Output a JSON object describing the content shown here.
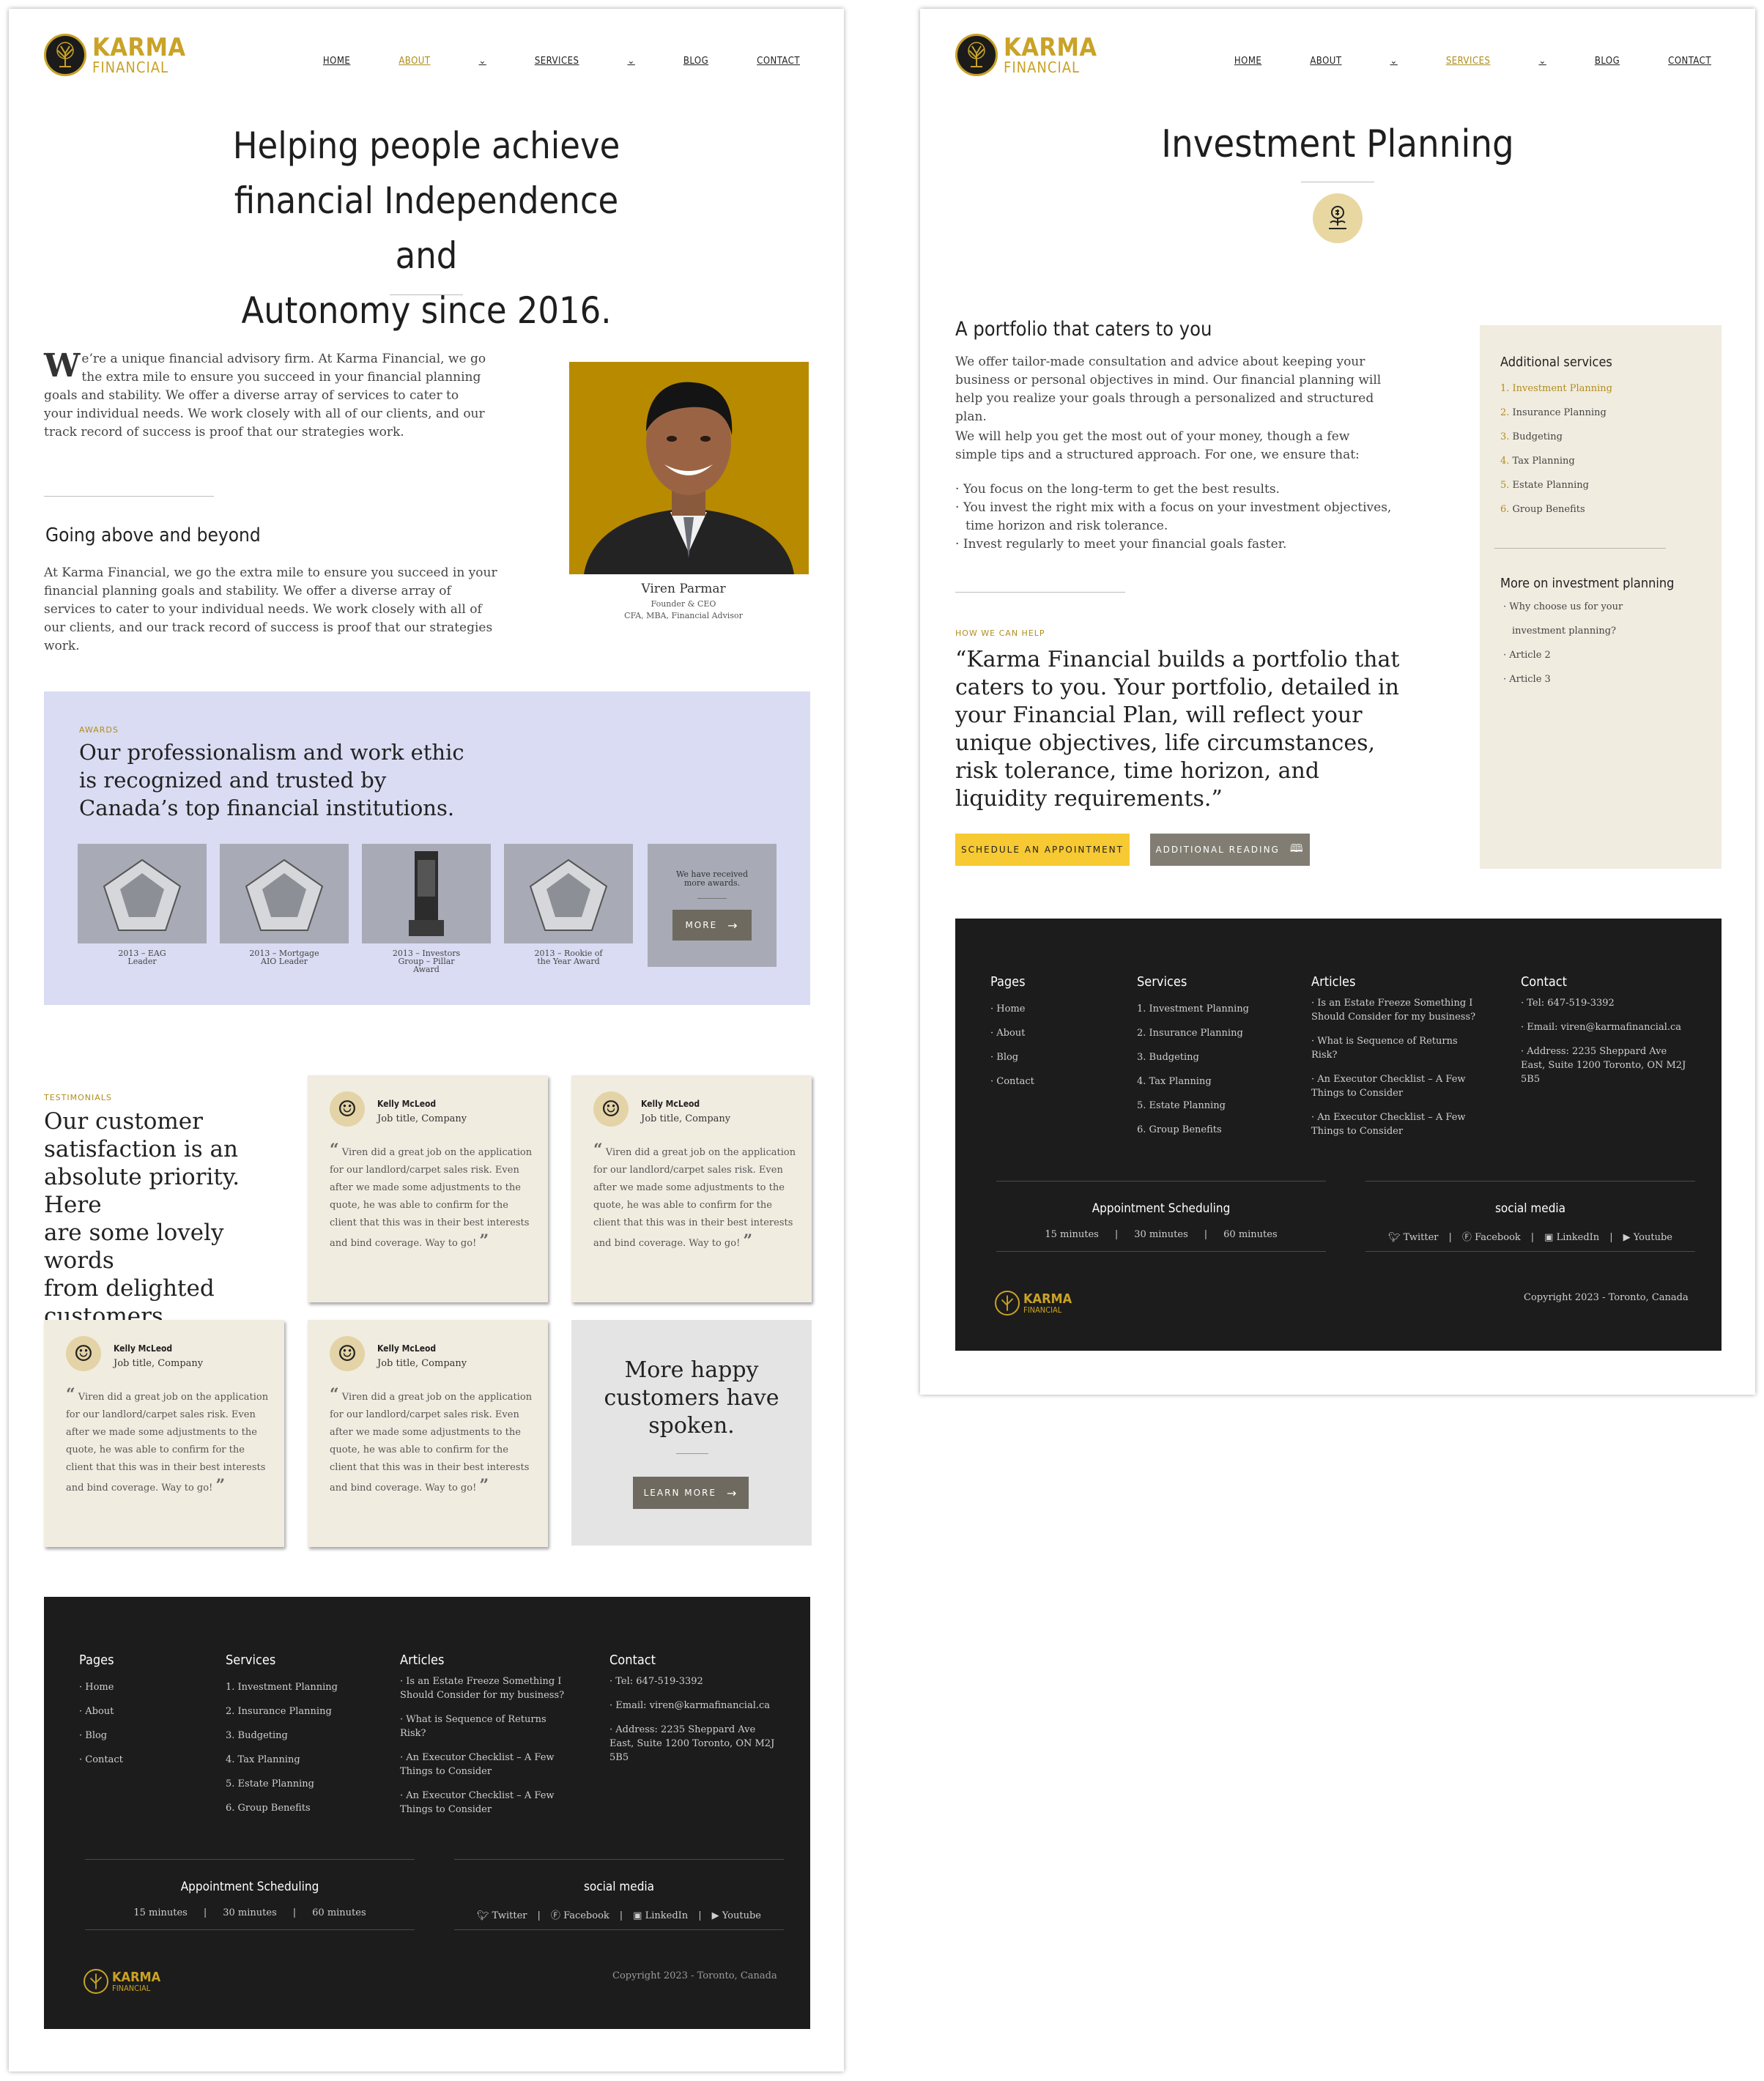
{
  "brand": {
    "name_top": "KARMA",
    "name_bottom": "FINANCIAL"
  },
  "nav": {
    "home": "HOME",
    "about": "ABOUT",
    "services": "SERVICES",
    "blog": "BLOG",
    "contact": "CONTACT"
  },
  "colors": {
    "gold": "#c9a227",
    "awards_bg": "#d9dcf2",
    "card_bg": "#f1ece0",
    "footer_bg": "#1c1c1c",
    "cta_yellow": "#f7c932",
    "button_gray": "#6e6a60"
  },
  "about": {
    "hero_lines": [
      "Helping people achieve",
      "financial Independence and",
      "Autonomy since 2016."
    ],
    "intro_dropcap": "W",
    "intro_text": "e’re a unique financial advisory firm. At Karma Financial, we go the extra mile to ensure you succeed in your financial planning goals and stability. We offer a diverse array of services to cater to your individual needs. We work closely with all of our clients, and our track record of success is proof that our strategies work.",
    "section_title": "Going above and beyond",
    "section_text": "At Karma Financial, we go the extra mile to ensure you succeed in your financial planning goals and stability. We offer a diverse array of services to cater to your individual needs. We work closely with all of our clients, and our track record of success is proof that our strategies work.",
    "person": {
      "name": "Viren Parmar",
      "title": "Founder & CEO",
      "credentials": "CFA, MBA, Financial Advisor"
    },
    "awards": {
      "eyebrow": "AWARDS",
      "heading_lines": [
        "Our professionalism and work ethic",
        "is recognized and trusted by",
        "Canada’s top financial institutions."
      ],
      "items": [
        {
          "caption_lines": [
            "2013 – EAG",
            "Leader"
          ]
        },
        {
          "caption_lines": [
            "2013 – Mortgage",
            "AIO Leader"
          ]
        },
        {
          "caption_lines": [
            "2013 – Investors",
            "Group – Pillar",
            "Award"
          ]
        },
        {
          "caption_lines": [
            "2013 – Rookie of",
            "the Year Award"
          ]
        }
      ],
      "more_text_lines": [
        "We have received",
        "more awards."
      ],
      "more_button": "MORE"
    },
    "testimonials": {
      "eyebrow": "TESTIMONIALS",
      "heading_lines": [
        "Our customer",
        "satisfaction is an",
        "absolute priority. Here",
        "are some lovely words",
        "from delighted",
        "customers."
      ],
      "cards": [
        {
          "name": "Kelly McLeod",
          "role": "Job title, Company",
          "quote": "Viren did a great job on the application for our landlord/carpet sales risk. Even after we made some adjustments to the quote, he was able to confirm for the client that this was in their best interests and bind coverage. Way to go!"
        },
        {
          "name": "Kelly McLeod",
          "role": "Job title, Company",
          "quote": "Viren did a great job on the application for our landlord/carpet sales risk. Even after we made some adjustments to the quote, he was able to confirm for the client that this was in their best interests and bind coverage. Way to go!"
        },
        {
          "name": "Kelly McLeod",
          "role": "Job title, Company",
          "quote": "Viren did a great job on the application for our landlord/carpet sales risk. Even after we made some adjustments to the quote, he was able to confirm for the client that this was in their best interests and bind coverage. Way to go!"
        },
        {
          "name": "Kelly McLeod",
          "role": "Job title, Company",
          "quote": "Viren did a great job on the application for our landlord/carpet sales risk. Even after we made some adjustments to the quote, he was able to confirm for the client that this was in their best interests and bind coverage. Way to go!"
        }
      ],
      "more_lines": [
        "More happy",
        "customers have",
        "spoken."
      ],
      "learn_more": "LEARN MORE"
    }
  },
  "footer": {
    "pages_title": "Pages",
    "pages": [
      "Home",
      "About",
      "Blog",
      "Contact"
    ],
    "services_title": "Services",
    "services": [
      "1. Investment Planning",
      "2. Insurance Planning",
      "3. Budgeting",
      "4. Tax Planning",
      "5. Estate Planning",
      "6. Group Benefits"
    ],
    "articles_title": "Articles",
    "articles": [
      "Is an Estate Freeze Something I Should Consider for my business?",
      "What is Sequence of Returns Risk?",
      "An Executor Checklist – A Few Things to Consider",
      "An Executor Checklist – A Few Things to Consider"
    ],
    "contact_title": "Contact",
    "contact": [
      "Tel: 647-519-3392",
      "Email: viren@karmafinancial.ca",
      "Address: 2235 Sheppard Ave East, Suite 1200 Toronto, ON M2J 5B5"
    ],
    "appointment_title": "Appointment Scheduling",
    "appointments": [
      "15 minutes",
      "30 minutes",
      "60 minutes"
    ],
    "social_title": "social media",
    "social": [
      "Twitter",
      "Facebook",
      "LinkedIn",
      "Youtube"
    ],
    "separator": "|",
    "copyright": "Copyright 2023 - Toronto, Canada"
  },
  "service": {
    "title": "Investment Planning",
    "subtitle": "A portfolio that caters to you",
    "para1": "We offer tailor-made consultation and advice about keeping your business or personal objectives in mind. Our financial planning will help you realize your goals through a personalized and structured plan.",
    "para2": "We will help you get the most out of your money, though a few simple tips and a structured approach. For one, we ensure that:",
    "bullets": [
      "You focus on the long-term to get the best results.",
      "You invest the right mix with a focus on your investment objectives, time horizon and risk tolerance.",
      "Invest regularly to meet your financial goals faster."
    ],
    "eyebrow": "HOW WE CAN HELP",
    "quote": "“Karma Financial builds a portfolio that caters to you. Your portfolio, detailed in your Financial Plan, will reflect your unique objectives, life circumstances, risk tolerance, time horizon, and liquidity requirements.”",
    "cta_primary": "SCHEDULE AN APPOINTMENT",
    "cta_secondary": "ADDITIONAL READING",
    "sidebar": {
      "additional_title": "Additional services",
      "additional": [
        {
          "num": "1.",
          "label": "Investment Planning"
        },
        {
          "num": "2.",
          "label": "Insurance Planning"
        },
        {
          "num": "3.",
          "label": "Budgeting"
        },
        {
          "num": "4.",
          "label": "Tax Planning"
        },
        {
          "num": "5.",
          "label": "Estate Planning"
        },
        {
          "num": "6.",
          "label": "Group Benefits"
        }
      ],
      "more_title": "More on investment planning",
      "more_line1": "Why choose us for your",
      "more_line2": "investment planning?",
      "more_items": [
        "Article 2",
        "Article 3"
      ]
    }
  }
}
